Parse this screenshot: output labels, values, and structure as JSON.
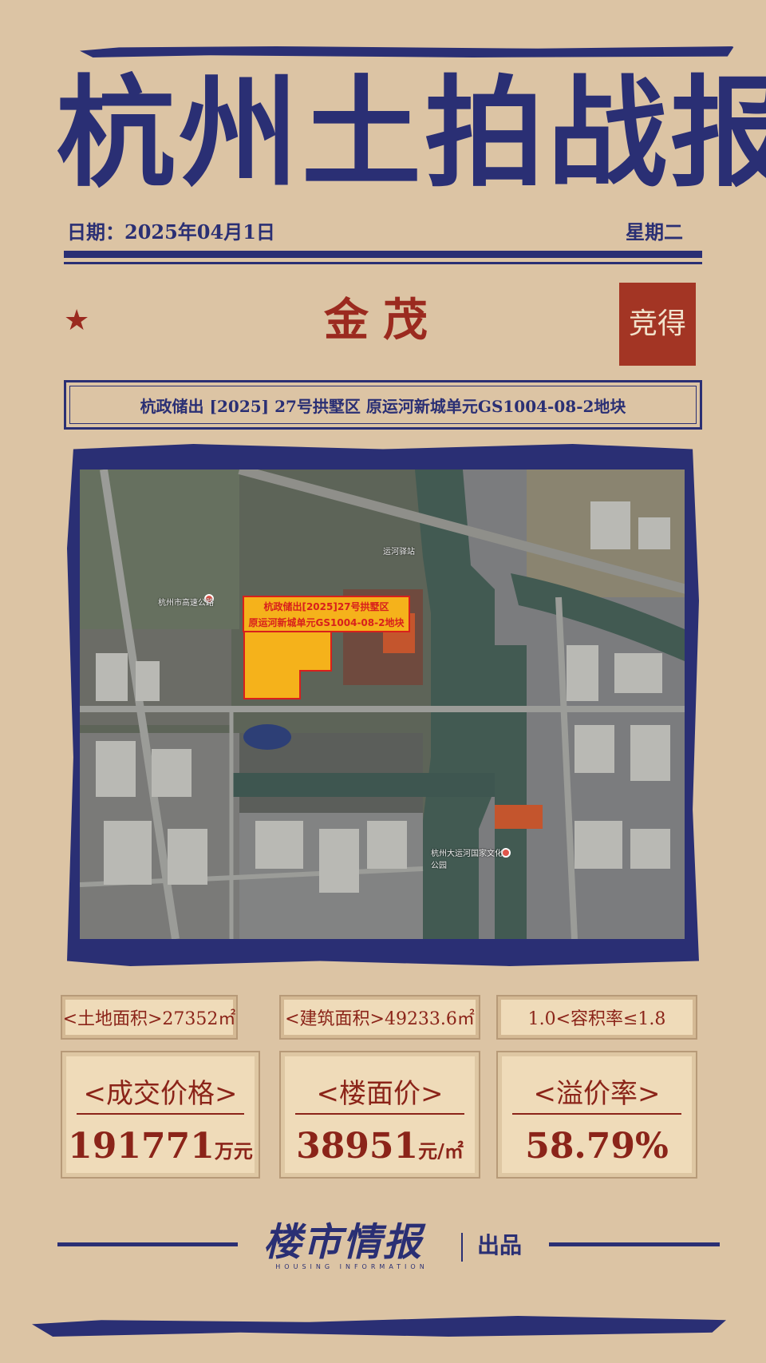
{
  "header": {
    "title": "杭州土拍战报",
    "date": "日期：2025年04月1日",
    "weekday": "星期二"
  },
  "result": {
    "winner": "金茂",
    "badge": "竞得"
  },
  "plot": {
    "name": "杭政储出 [2025] 27号拱墅区  原运河新城单元GS1004-08-2地块"
  },
  "map": {
    "callout_line1": "杭政储出[2025]27号拱墅区",
    "callout_line2": "原运河新城单元GS1004-08-2地块",
    "labels": {
      "poi_1": "杭州市高速公路",
      "poi_2": "杭州大运河国家文化公园",
      "poi_3": "运河驿站"
    }
  },
  "stats": {
    "land_area": "<土地面积>27352㎡",
    "building_area": "<建筑面积>49233.6㎡",
    "far": "1.0<容积率≤1.8",
    "deal_price_label": "<成交价格>",
    "deal_price_value": "191771",
    "deal_price_unit": "万元",
    "floor_price_label": "<楼面价>",
    "floor_price_value": "38951",
    "floor_price_unit": "元/㎡",
    "premium_label": "<溢价率>",
    "premium_value": "58.79%"
  },
  "footer": {
    "brand": "楼市情报",
    "brand_sub": "HOUSING INFORMATION",
    "produced": "出品"
  },
  "colors": {
    "navy": "#2a2f74",
    "red": "#8b2419",
    "background": "#dcc4a4",
    "plot_fill": "#f5b21b"
  }
}
